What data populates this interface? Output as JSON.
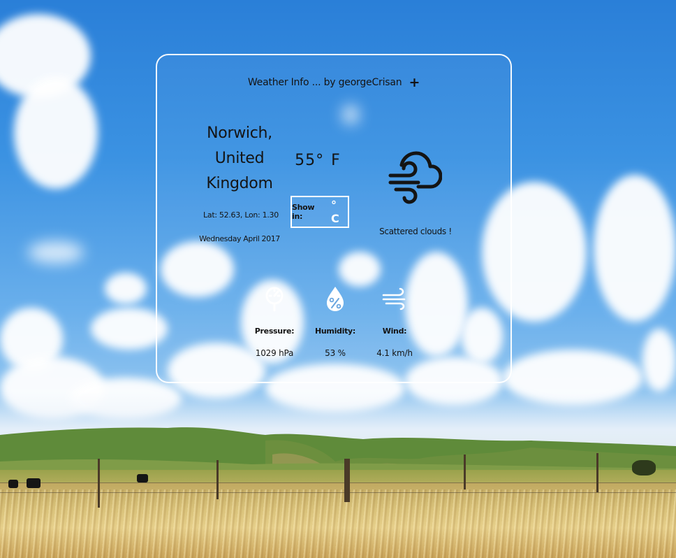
{
  "header": {
    "title": "Weather Info ... by georgeCrisan",
    "add_label": "+"
  },
  "location": {
    "city_lines": [
      "Norwich,",
      "United",
      "Kingdom"
    ],
    "coords": "Lat: 52.63, Lon: 1.30",
    "date": "Wednesday April 2017"
  },
  "temperature": {
    "value": "55",
    "degree": "°",
    "unit": "F"
  },
  "toggle": {
    "label": "Show in:",
    "unit": "° C"
  },
  "condition": {
    "text": "Scattered clouds !",
    "icon": "cloud-wind-icon"
  },
  "stats": {
    "pressure": {
      "label": "Pressure:",
      "value": "1029 hPa",
      "icon": "barometer-icon"
    },
    "humidity": {
      "label": "Humidity:",
      "value": "53 %",
      "icon": "humidity-drop-icon"
    },
    "wind": {
      "label": "Wind:",
      "value": "4.1 km/h",
      "icon": "wind-icon"
    }
  },
  "colors": {
    "text": "#141414",
    "border": "#ffffff",
    "sky": "#2a7fd8"
  }
}
